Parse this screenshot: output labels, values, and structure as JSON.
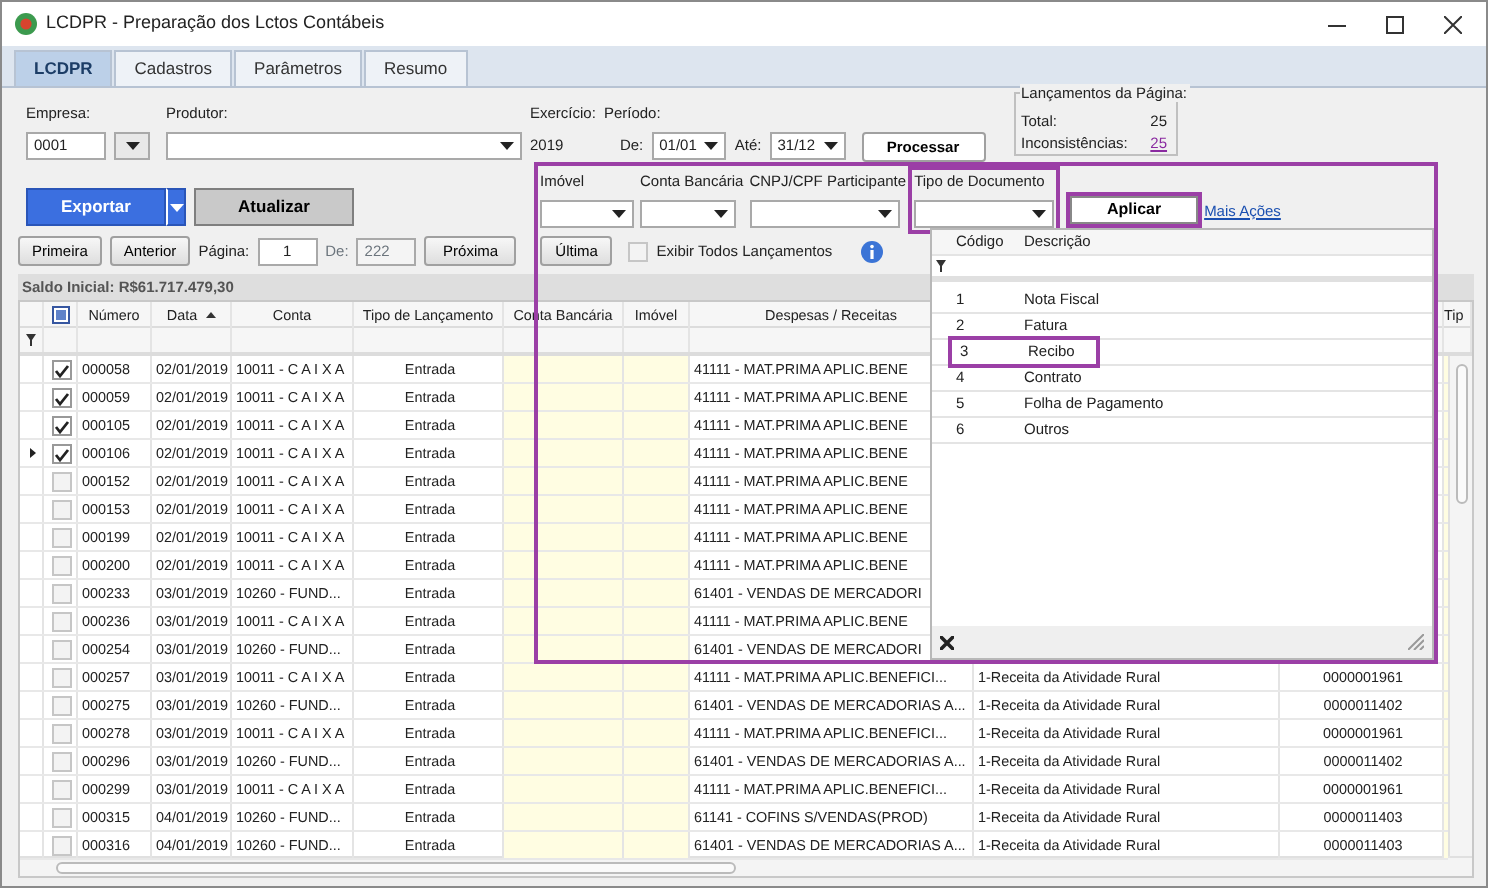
{
  "window": {
    "title": "LCDPR - Preparação dos Lctos Contábeis"
  },
  "tabs": [
    {
      "label": "LCDPR",
      "selected": true
    },
    {
      "label": "Cadastros",
      "selected": false
    },
    {
      "label": "Parâmetros",
      "selected": false
    },
    {
      "label": "Resumo",
      "selected": false
    }
  ],
  "header_form": {
    "empresa_label": "Empresa:",
    "empresa_value": "0001",
    "produtor_label": "Produtor:",
    "exercicio_label": "Exercício:",
    "exercicio_value": "2019",
    "periodo_label": "Período:",
    "de_label": "De:",
    "de_value": "01/01",
    "ate_label": "Até:",
    "ate_value": "31/12",
    "process_button": "Processar"
  },
  "page_summary": {
    "title": "Lançamentos da Página:",
    "total_label": "Total:",
    "total_value": "25",
    "inconsistencias_label": "Inconsistências:",
    "inconsistencias_value": "25"
  },
  "actions": {
    "export_button": "Exportar",
    "refresh_button": "Atualizar"
  },
  "pager": {
    "first": "Primeira",
    "previous": "Anterior",
    "page_label": "Página:",
    "page_value": "1",
    "of_label": "De:",
    "of_value": "222",
    "next": "Próxima",
    "last": "Última",
    "show_all": {
      "label": "Exibir Todos Lançamentos",
      "checked": false
    }
  },
  "balance": "Saldo Inicial: R$61.717.479,30",
  "grid": {
    "select_all": {
      "indeterminate": true
    },
    "columns": [
      {
        "label": "Número",
        "sorted_ascending": false
      },
      {
        "label": "Data",
        "sorted_ascending": true
      },
      {
        "label": "Conta",
        "sorted_ascending": false
      },
      {
        "label": "Tipo de Lançamento",
        "sorted_ascending": false
      },
      {
        "label": "Conta Bancária",
        "sorted_ascending": false
      },
      {
        "label": "Imóvel",
        "sorted_ascending": false
      },
      {
        "label": "Despesas / Receitas",
        "sorted_ascending": false
      }
    ],
    "cut_column_header": "Tip",
    "rows": [
      {
        "checked": true,
        "current": false,
        "numero": "000058",
        "data": "02/01/2019",
        "conta": "10011 - C A I X A",
        "tipo": "Entrada",
        "despesas": "41111 - MAT.PRIMA APLIC.BENE"
      },
      {
        "checked": true,
        "current": false,
        "numero": "000059",
        "data": "02/01/2019",
        "conta": "10011 - C A I X A",
        "tipo": "Entrada",
        "despesas": "41111 - MAT.PRIMA APLIC.BENE"
      },
      {
        "checked": true,
        "current": false,
        "numero": "000105",
        "data": "02/01/2019",
        "conta": "10011 - C A I X A",
        "tipo": "Entrada",
        "despesas": "41111 - MAT.PRIMA APLIC.BENE"
      },
      {
        "checked": true,
        "current": true,
        "numero": "000106",
        "data": "02/01/2019",
        "conta": "10011 - C A I X A",
        "tipo": "Entrada",
        "despesas": "41111 - MAT.PRIMA APLIC.BENE"
      },
      {
        "checked": false,
        "current": false,
        "numero": "000152",
        "data": "02/01/2019",
        "conta": "10011 - C A I X A",
        "tipo": "Entrada",
        "despesas": "41111 - MAT.PRIMA APLIC.BENE"
      },
      {
        "checked": false,
        "current": false,
        "numero": "000153",
        "data": "02/01/2019",
        "conta": "10011 - C A I X A",
        "tipo": "Entrada",
        "despesas": "41111 - MAT.PRIMA APLIC.BENE"
      },
      {
        "checked": false,
        "current": false,
        "numero": "000199",
        "data": "02/01/2019",
        "conta": "10011 - C A I X A",
        "tipo": "Entrada",
        "despesas": "41111 - MAT.PRIMA APLIC.BENE"
      },
      {
        "checked": false,
        "current": false,
        "numero": "000200",
        "data": "02/01/2019",
        "conta": "10011 - C A I X A",
        "tipo": "Entrada",
        "despesas": "41111 - MAT.PRIMA APLIC.BENE"
      },
      {
        "checked": false,
        "current": false,
        "numero": "000233",
        "data": "03/01/2019",
        "conta": "10260 - FUND...",
        "tipo": "Entrada",
        "despesas": "61401 - VENDAS DE MERCADORI"
      },
      {
        "checked": false,
        "current": false,
        "numero": "000236",
        "data": "03/01/2019",
        "conta": "10011 - C A I X A",
        "tipo": "Entrada",
        "despesas": "41111 - MAT.PRIMA APLIC.BENE"
      },
      {
        "checked": false,
        "current": false,
        "numero": "000254",
        "data": "03/01/2019",
        "conta": "10260 - FUND...",
        "tipo": "Entrada",
        "despesas": "61401 - VENDAS DE MERCADORI"
      },
      {
        "checked": false,
        "current": false,
        "numero": "000257",
        "data": "03/01/2019",
        "conta": "10011 - C A I X A",
        "tipo": "Entrada",
        "despesas": "41111 - MAT.PRIMA APLIC.BENEFICI...",
        "column_8": "1-Receita da Atividade Rural",
        "column_9": "0000001961"
      },
      {
        "checked": false,
        "current": false,
        "numero": "000275",
        "data": "03/01/2019",
        "conta": "10260 - FUND...",
        "tipo": "Entrada",
        "despesas": "61401 - VENDAS DE MERCADORIAS A...",
        "column_8": "1-Receita da Atividade Rural",
        "column_9": "0000011402"
      },
      {
        "checked": false,
        "current": false,
        "numero": "000278",
        "data": "03/01/2019",
        "conta": "10011 - C A I X A",
        "tipo": "Entrada",
        "despesas": "41111 - MAT.PRIMA APLIC.BENEFICI...",
        "column_8": "1-Receita da Atividade Rural",
        "column_9": "0000001961"
      },
      {
        "checked": false,
        "current": false,
        "numero": "000296",
        "data": "03/01/2019",
        "conta": "10260 - FUND...",
        "tipo": "Entrada",
        "despesas": "61401 - VENDAS DE MERCADORIAS A...",
        "column_8": "1-Receita da Atividade Rural",
        "column_9": "0000011402"
      },
      {
        "checked": false,
        "current": false,
        "numero": "000299",
        "data": "03/01/2019",
        "conta": "10011 - C A I X A",
        "tipo": "Entrada",
        "despesas": "41111 - MAT.PRIMA APLIC.BENEFICI...",
        "column_8": "1-Receita da Atividade Rural",
        "column_9": "0000001961"
      },
      {
        "checked": false,
        "current": false,
        "numero": "000315",
        "data": "04/01/2019",
        "conta": "10260 - FUND...",
        "tipo": "Entrada",
        "despesas": "61141 - COFINS S/VENDAS(PROD)",
        "column_8": "1-Receita da Atividade Rural",
        "column_9": "0000011403"
      },
      {
        "checked": false,
        "current": false,
        "numero": "000316",
        "data": "04/01/2019",
        "conta": "10260 - FUND...",
        "tipo": "Entrada",
        "despesas": "61401 - VENDAS DE MERCADORIAS A...",
        "column_8": "1-Receita da Atividade Rural",
        "column_9": "0000011403"
      }
    ]
  },
  "filter_panel": {
    "highlighted": true,
    "fields": [
      {
        "label": "Imóvel",
        "highlighted": false
      },
      {
        "label": "Conta Bancária",
        "highlighted": false
      },
      {
        "label": "CNPJ/CPF Participante",
        "highlighted": false
      },
      {
        "label": "Tipo de Documento",
        "highlighted": true
      }
    ],
    "apply_button": {
      "label": "Aplicar",
      "highlighted": true
    },
    "more_link": "Mais Ações"
  },
  "document_list": {
    "columns": [
      "Código",
      "Descrição"
    ],
    "items": [
      {
        "code": "1",
        "description": "Nota Fiscal",
        "highlighted": false
      },
      {
        "code": "2",
        "description": "Fatura",
        "highlighted": false
      },
      {
        "code": "3",
        "description": "Recibo",
        "highlighted": true
      },
      {
        "code": "4",
        "description": "Contrato",
        "highlighted": false
      },
      {
        "code": "5",
        "description": "Folha de Pagamento",
        "highlighted": false
      },
      {
        "code": "6",
        "description": "Outros",
        "highlighted": false
      }
    ]
  }
}
